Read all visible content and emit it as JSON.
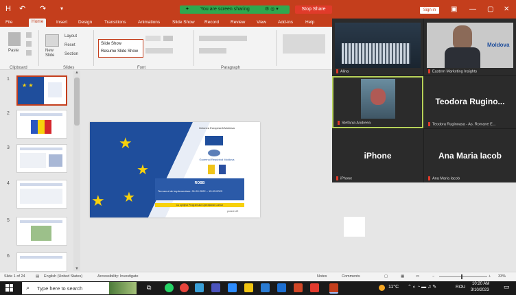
{
  "title_bar": {
    "quick_access": [
      "H",
      "↶",
      "↷",
      "▾"
    ],
    "share_status": "You are screen sharing",
    "stop_share": "Stop Share",
    "sign_in": "Sign in",
    "window_buttons": [
      "—",
      "▢",
      "✕"
    ]
  },
  "tabs": [
    "File",
    "Home",
    "Insert",
    "Design",
    "Transitions",
    "Animations",
    "Slide Show",
    "Record",
    "Review",
    "View",
    "Add-ins",
    "Help"
  ],
  "active_tab": "Home",
  "ribbon": {
    "paste_label": "Paste",
    "new_slide_label": "New Slide",
    "layout_label": "Layout",
    "reset_label": "Reset",
    "section_label": "Section",
    "font_box_line1": "Slide Show",
    "font_box_line2": "Resume Slide Show",
    "groups": [
      "Clipboard",
      "Slides",
      "Font",
      "Paragraph"
    ]
  },
  "thumbnails": [
    "1",
    "2",
    "3",
    "4",
    "5",
    "6"
  ],
  "slide": {
    "header_text": "Uniunea Europeană Moldova",
    "mid_text": "Guvernul Republicii Moldova",
    "box_title": "ROBB",
    "box_line": "Termenul de implementare: 01.09.2022 – 15.03.2023",
    "yellow_strip": "Cu sprijinul Programului Operațional Comun",
    "footer": "proiect UE"
  },
  "meeting": {
    "participants": [
      {
        "label": "Alina",
        "big_name": ""
      },
      {
        "label": "Eastern Marketing Insights",
        "big_name": ""
      },
      {
        "label": "Stefania Andreea",
        "big_name": ""
      },
      {
        "label": "Teodora Ruginoasa - As. Romane E...",
        "big_name": "Teodora Rugino..."
      },
      {
        "label": "iPhone",
        "big_name": "iPhone"
      },
      {
        "label": "Ana Maria Iacob",
        "big_name": "Ana Maria Iacob"
      }
    ],
    "banner_text": "Moldova"
  },
  "status_bar": {
    "slide_count": "Slide 1 of 24",
    "language": "English (United States)",
    "accessibility": "Accessibility: Investigate",
    "notes": "Notes",
    "comments": "Comments",
    "zoom": "33%"
  },
  "taskbar": {
    "search_placeholder": "Type here to search",
    "weather": "11°C",
    "lang": "ROU",
    "time": "10:20 AM",
    "date": "3/10/2023"
  },
  "colors": {
    "accent": "#c43e1c",
    "share_green": "#2fa84f",
    "stop_red": "#e03a2a",
    "slide_blue": "#1f4e9c",
    "star_yellow": "#f7d10c"
  }
}
